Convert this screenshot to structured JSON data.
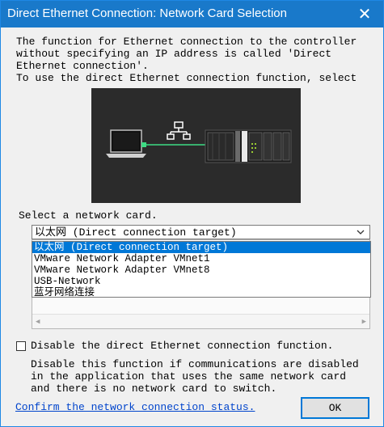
{
  "window": {
    "title": "Direct Ethernet Connection: Network Card Selection",
    "close_glyph": "✕"
  },
  "description": {
    "text": "The function for Ethernet connection to the controller\nwithout specifying an IP address is called 'Direct\nEthernet connection'.\nTo use the direct Ethernet connection function, select"
  },
  "network_card": {
    "label": "Select a network card.",
    "selected": "以太网 (Direct connection target)",
    "options": [
      "以太网 (Direct connection target)",
      "VMware Network Adapter VMnet1",
      "VMware Network Adapter VMnet8",
      "USB-Network",
      "蓝牙网络连接"
    ]
  },
  "disable_option": {
    "label": "Disable the direct Ethernet connection function.",
    "checked": false,
    "note": "Disable this function if communications are disabled\nin the application that uses the same network card\nand there is no network card to switch."
  },
  "footer": {
    "link": "Confirm the network connection status.",
    "ok_label": "OK"
  },
  "colors": {
    "titlebar": "#1979ca",
    "selection": "#0078d7",
    "link": "#0044cc",
    "connection_line": "#3ddc84"
  },
  "icons": [
    "close-icon",
    "laptop-icon",
    "network-icon",
    "controller-icon",
    "chevron-down-icon"
  ]
}
